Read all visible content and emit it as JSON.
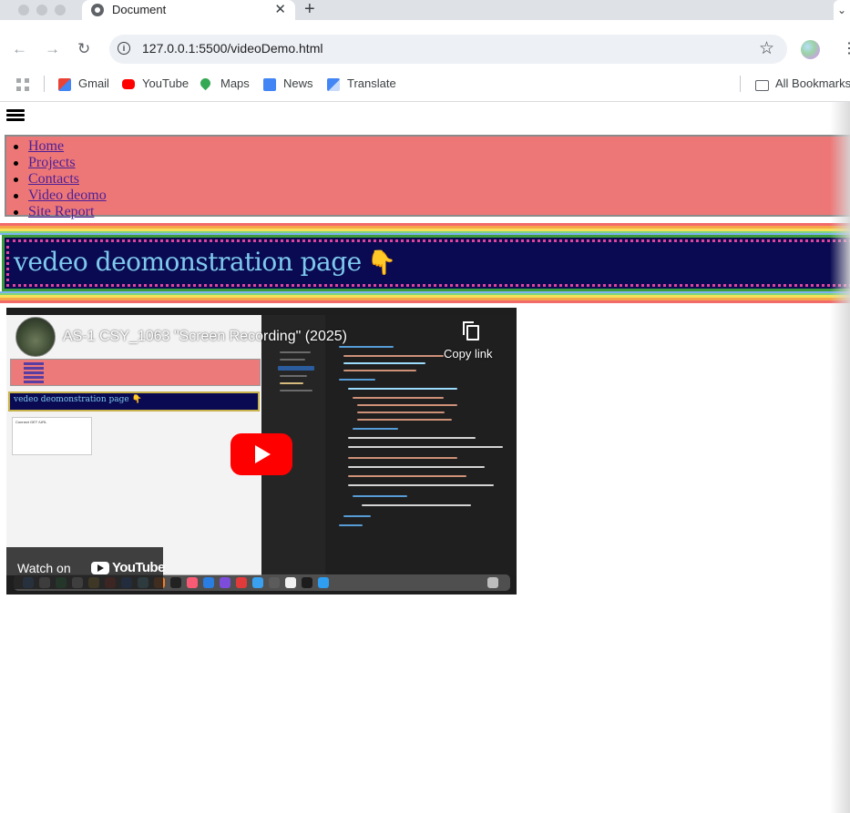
{
  "browser": {
    "tab_title": "Document",
    "tab_close": "✕",
    "new_tab": "+",
    "tab_menu": "⌄",
    "url": "127.0.0.1:5500/videoDemo.html",
    "bookmarks": [
      {
        "label": "Gmail",
        "icon": "gmail-icon",
        "color": "#ea4335"
      },
      {
        "label": "YouTube",
        "icon": "youtube-icon",
        "color": "#ff0000"
      },
      {
        "label": "Maps",
        "icon": "maps-icon",
        "color": "#34a853"
      },
      {
        "label": "News",
        "icon": "news-icon",
        "color": "#4285f4"
      },
      {
        "label": "Translate",
        "icon": "translate-icon",
        "color": "#4285f4"
      }
    ],
    "all_bookmarks": "All Bookmarks"
  },
  "nav": {
    "items": [
      "Home",
      "Projects",
      "Contacts",
      "Video deomo",
      "Site Report"
    ],
    "link_color": "#4d1f96",
    "background": "#ed7777"
  },
  "banner": {
    "title": "vedeo deomonstration page",
    "emoji": "👇",
    "background": "#0a0a52",
    "text_color": "#7ec9ee"
  },
  "video": {
    "title": "AS-1 CSY_1063 \"Screen Recording\" (2025)",
    "copy_link": "Copy link",
    "watch_on": "Watch on",
    "brand": "YouTube",
    "mini_banner": "vedeo deomonstration page 👇",
    "mini_box": "Connect GET /URL"
  }
}
